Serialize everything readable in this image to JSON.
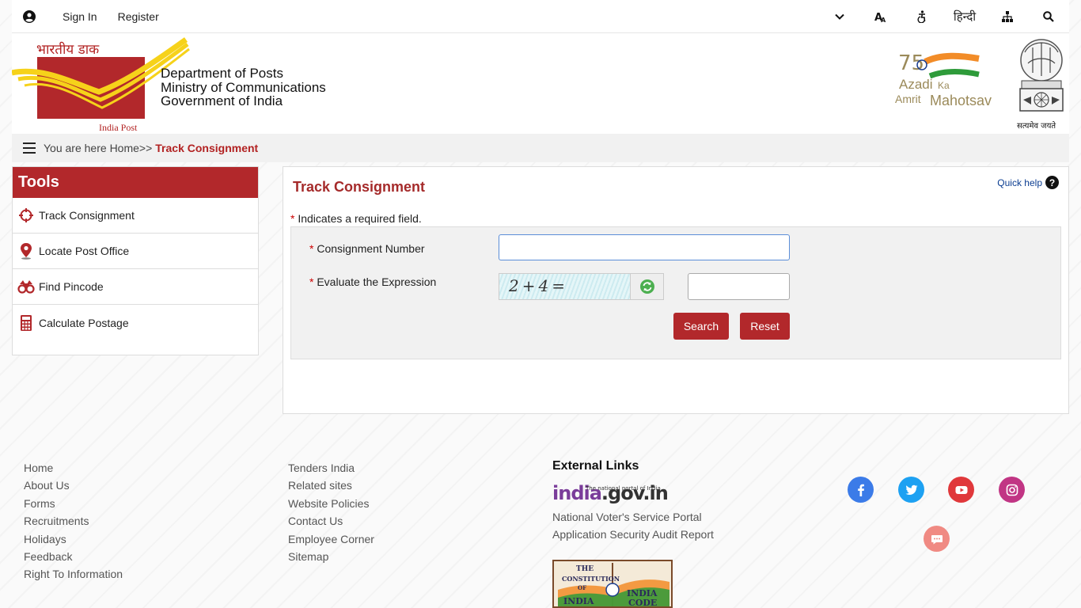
{
  "topbar": {
    "sign_in": "Sign In",
    "register": "Register",
    "hindi": "हिन्दी"
  },
  "header": {
    "logo_hindi": "भारतीय डाक",
    "logo_english": "India Post",
    "dept_line1": "Department of Posts",
    "dept_line2": "Ministry of Communications",
    "dept_line3": "Government of India",
    "azadi_75": "75",
    "azadi_line1": "Azadi",
    "azadi_ka": "Ka",
    "azadi_amrit": "Amrit",
    "azadi_mahotsav": "Mahotsav",
    "emblem_motto": "सत्यमेव जयते"
  },
  "breadcrumb": {
    "prefix": "You are here",
    "home": "Home",
    "separator": ">>",
    "current": "Track Consignment"
  },
  "tools": {
    "title": "Tools",
    "items": [
      {
        "label": "Track Consignment",
        "icon": "crosshair-icon"
      },
      {
        "label": "Locate Post Office",
        "icon": "map-pin-icon"
      },
      {
        "label": "Find Pincode",
        "icon": "binoculars-icon"
      },
      {
        "label": "Calculate Postage",
        "icon": "calculator-icon"
      }
    ]
  },
  "main": {
    "title": "Track Consignment",
    "quick_help": "Quick help",
    "required_note": " Indicates a required field.",
    "consignment_label": " Consignment Number",
    "consignment_value": "",
    "expression_label": " Evaluate the Expression",
    "captcha_text": "2+4=",
    "expression_value": "",
    "search_label": "Search",
    "reset_label": "Reset"
  },
  "footer": {
    "col1": [
      "Home",
      "About Us",
      "Forms",
      "Recruitments",
      "Holidays",
      "Feedback",
      "Right To Information"
    ],
    "col2": [
      "Tenders India",
      "Related sites",
      "Website Policies",
      "Contact Us",
      "Employee Corner",
      "Sitemap"
    ],
    "external_title": "External Links",
    "indiagov_tagline": "The national portal of India",
    "indiagov_india": "india",
    "indiagov_rest": ".gov.in",
    "external_links": [
      "National Voter's Service Portal",
      "Application Security Audit Report"
    ],
    "constitution_line1": "THE",
    "constitution_line2": "CONSTITUTION",
    "constitution_line3": "OF",
    "constitution_line4": "INDIA",
    "constitution_line5": "INDIA",
    "constitution_line6": "CODE"
  },
  "colors": {
    "brand_red": "#b2282b",
    "title_red": "#a52a2a",
    "facebook": "#3b7be8",
    "twitter": "#1da1f2",
    "youtube": "#e0383b",
    "instagram": "#c13584",
    "chat": "#f08a83"
  }
}
